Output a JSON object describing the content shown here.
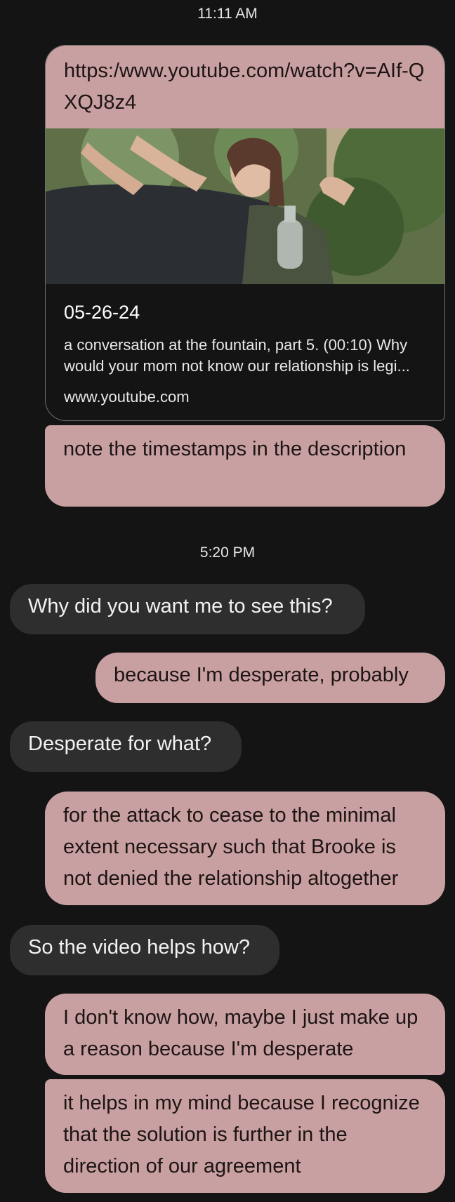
{
  "conversation": {
    "timestamp_1": "11:11 AM",
    "link_preview": {
      "url": "https:/www.youtube.com/watch?v=AIf-QXQJ8z4",
      "title": "05-26-24",
      "description": "a conversation at the fountain, part 5. (00:10) Why would your mom not know our relationship is legi...",
      "domain": "www.youtube.com",
      "thumbnail": "video-thumbnail"
    },
    "message_1": "note the timestamps in the description",
    "timestamp_2": "5:20 PM",
    "message_2": "Why did you want me to see this?",
    "message_3": "because I'm desperate, probably",
    "message_4": "Desperate for what?",
    "message_5": "for the attack to cease to the minimal extent necessary such that Brooke is not denied the relationship altogether",
    "message_6": "So the video helps how?",
    "message_7": "I don't know how, maybe I just make up a reason because I'm desperate",
    "message_8": "it helps in my mind because I recognize that the solution is further in the direction of our agreement"
  },
  "colors": {
    "background": "#141414",
    "outgoing_bubble": "#c9a0a2",
    "incoming_bubble": "#2e2e2e"
  }
}
